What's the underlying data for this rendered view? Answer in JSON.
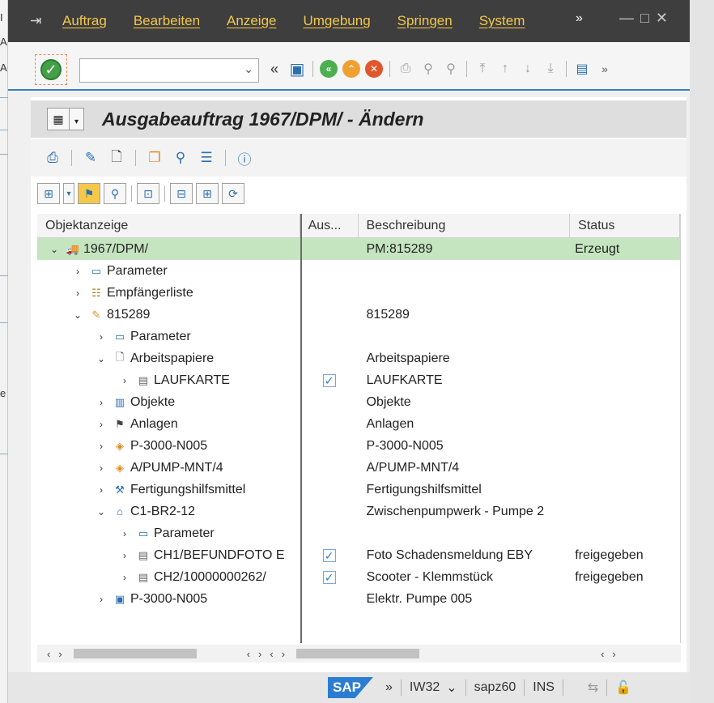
{
  "menubar": {
    "items": [
      "Auftrag",
      "Bearbeiten",
      "Anzeige",
      "Umgebung",
      "Springen",
      "System"
    ],
    "more": "»"
  },
  "toolbar": {
    "back": "«",
    "more": "»"
  },
  "title": "Ausgabeauftrag 1967/DPM/ - Ändern",
  "tree": {
    "headers": [
      "Objektanzeige",
      "Aus...",
      "Beschreibung",
      "Status"
    ],
    "rows": [
      {
        "indent": 0,
        "exp": "⌄",
        "icon": "truck-icon",
        "name": "1967/DPM/",
        "check": false,
        "desc": "PM:815289",
        "status": "Erzeugt",
        "selected": true
      },
      {
        "indent": 1,
        "exp": "›",
        "icon": "parameter-icon",
        "name": "Parameter",
        "check": false,
        "desc": "",
        "status": ""
      },
      {
        "indent": 1,
        "exp": "›",
        "icon": "recipients-icon",
        "name": "Empfängerliste",
        "check": false,
        "desc": "",
        "status": ""
      },
      {
        "indent": 1,
        "exp": "⌄",
        "icon": "order-icon",
        "name": "815289",
        "check": false,
        "desc": "815289",
        "status": ""
      },
      {
        "indent": 2,
        "exp": "›",
        "icon": "parameter-icon",
        "name": "Parameter",
        "check": false,
        "desc": "",
        "status": ""
      },
      {
        "indent": 2,
        "exp": "⌄",
        "icon": "document-icon",
        "name": "Arbeitspapiere",
        "check": false,
        "desc": "Arbeitspapiere",
        "status": ""
      },
      {
        "indent": 3,
        "exp": "›",
        "icon": "form-icon",
        "name": "LAUFKARTE",
        "check": true,
        "desc": "LAUFKARTE",
        "status": ""
      },
      {
        "indent": 2,
        "exp": "›",
        "icon": "objects-icon",
        "name": "Objekte",
        "check": false,
        "desc": "Objekte",
        "status": ""
      },
      {
        "indent": 2,
        "exp": "›",
        "icon": "equipment-icon",
        "name": "Anlagen",
        "check": false,
        "desc": "Anlagen",
        "status": ""
      },
      {
        "indent": 2,
        "exp": "›",
        "icon": "operation-icon",
        "name": "P-3000-N005",
        "check": false,
        "desc": "P-3000-N005",
        "status": ""
      },
      {
        "indent": 2,
        "exp": "›",
        "icon": "operation-icon",
        "name": "A/PUMP-MNT/4",
        "check": false,
        "desc": "A/PUMP-MNT/4",
        "status": ""
      },
      {
        "indent": 2,
        "exp": "›",
        "icon": "tool-icon",
        "name": "Fertigungshilfsmittel",
        "check": false,
        "desc": "Fertigungshilfsmittel",
        "status": ""
      },
      {
        "indent": 2,
        "exp": "⌄",
        "icon": "location-icon",
        "name": "C1-BR2-12",
        "check": false,
        "desc": "Zwischenpumpwerk - Pumpe 2",
        "status": ""
      },
      {
        "indent": 3,
        "exp": "›",
        "icon": "parameter-icon",
        "name": "Parameter",
        "check": false,
        "desc": "",
        "status": ""
      },
      {
        "indent": 3,
        "exp": "›",
        "icon": "attachment-icon",
        "name": "CH1/BEFUNDFOTO E",
        "check": true,
        "desc": "Foto Schadensmeldung EBY",
        "status": "freigegeben"
      },
      {
        "indent": 3,
        "exp": "›",
        "icon": "attachment-icon",
        "name": "CH2/10000000262/",
        "check": true,
        "desc": "Scooter - Klemmstück",
        "status": "freigegeben"
      },
      {
        "indent": 2,
        "exp": "›",
        "icon": "machine-icon",
        "name": "P-3000-N005",
        "check": false,
        "desc": "Elektr. Pumpe 005",
        "status": ""
      }
    ]
  },
  "status": {
    "logo": "SAP",
    "more": "»",
    "transaction": "IW32",
    "server": "sapz60",
    "mode": "INS"
  },
  "background_window": {
    "chars": [
      "I",
      "A",
      "A",
      "e"
    ]
  }
}
